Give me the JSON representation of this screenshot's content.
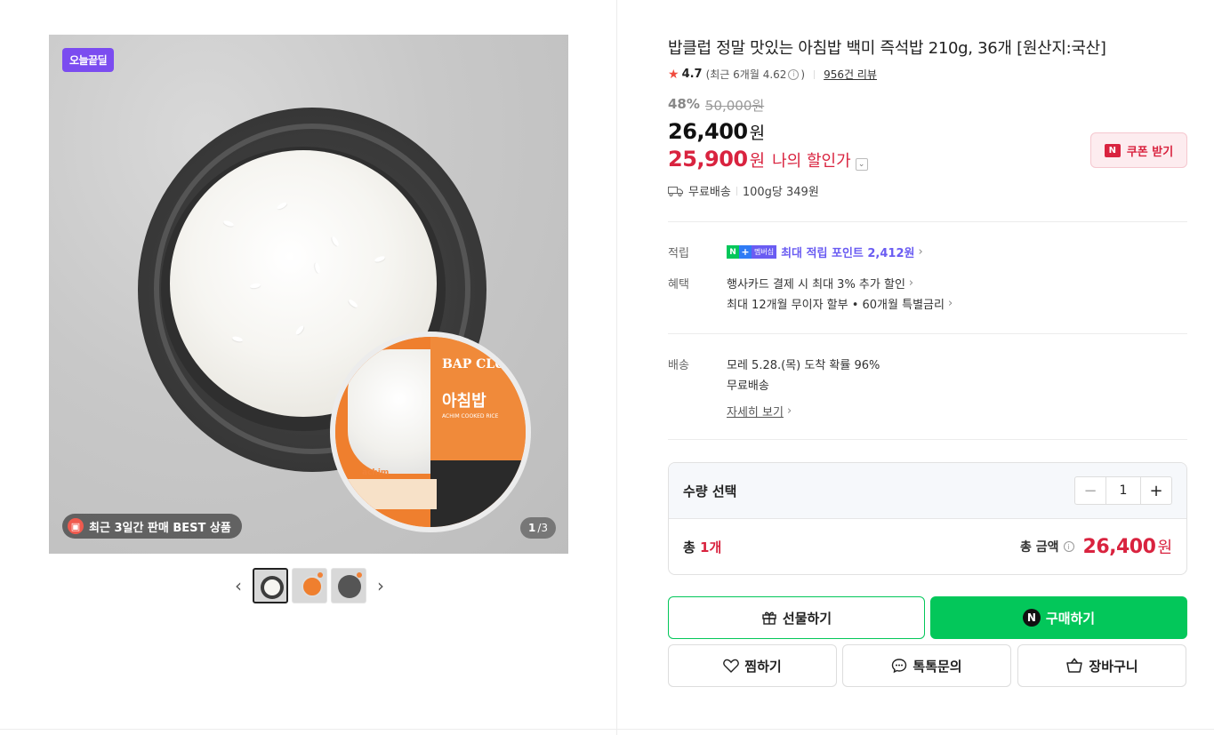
{
  "gallery": {
    "deal_badge": "오늘끝딜",
    "best_badge": "최근 3일간 판매 BEST 상품",
    "page_current": "1",
    "page_total": "/3",
    "package_title": "BAP CLUB",
    "package_subtitle": "아침밥",
    "package_english": "ACHIM COOKED RICE",
    "package_brand": "achim",
    "prev_icon": "chevron-left-icon",
    "next_icon": "chevron-right-icon"
  },
  "product": {
    "title": "밥클럽 정말 맛있는 아침밥 백미 즉석밥 210g, 36개 [원산지:국산]",
    "rating": "4.7",
    "recent_rating_prefix": "(최근 6개월 4.62",
    "recent_rating_suffix": ")",
    "review_link": "956건 리뷰",
    "discount_rate": "48%",
    "original_price": "50,000원",
    "price": "26,400",
    "price_unit": "원",
    "my_price": "25,900",
    "my_price_unit": "원",
    "my_price_label": "나의 할인가",
    "coupon_button": "쿠폰 받기",
    "shipping": "무료배송",
    "unit_price": "100g당 349원"
  },
  "benefits": {
    "points_label": "적립",
    "membership_badge": "멤버십",
    "points_text": "최대 적립 포인트 2,412원",
    "benefit_label": "혜택",
    "card_benefit": "행사카드 결제 시 최대 3% 추가 할인",
    "installment": "최대 12개월 무이자 할부 • 60개월 특별금리"
  },
  "delivery": {
    "label": "배송",
    "eta": "모레 5.28.(목) 도착 확률 96%",
    "fee": "무료배송",
    "details_link": "자세히 보기"
  },
  "quantity": {
    "label": "수량 선택",
    "value": "1",
    "total_prefix": "총 ",
    "total_count": "1개",
    "total_label": "총 금액",
    "total_price": "26,400",
    "total_unit": "원"
  },
  "actions": {
    "gift": "선물하기",
    "buy": "구매하기",
    "wishlist": "찜하기",
    "talk": "톡톡문의",
    "cart": "장바구니"
  },
  "colors": {
    "accent_red": "#d9233f",
    "naver_green": "#03c75a",
    "deal_purple": "#7b4cf0"
  }
}
